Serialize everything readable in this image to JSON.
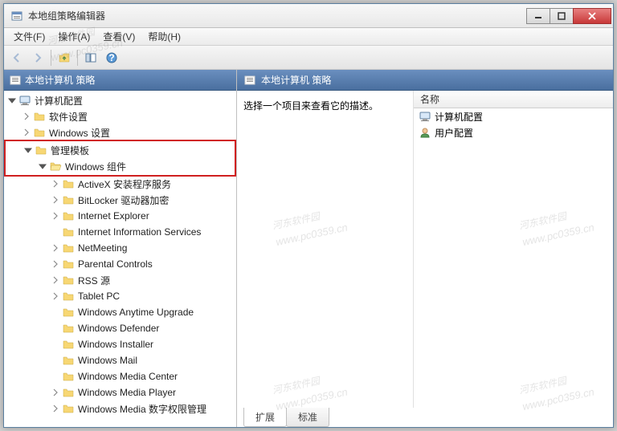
{
  "window": {
    "title": "本地组策略编辑器"
  },
  "menu": {
    "file": "文件(F)",
    "action": "操作(A)",
    "view": "查看(V)",
    "help": "帮助(H)"
  },
  "tree": {
    "root": "本地计算机 策略",
    "computer_config": "计算机配置",
    "software_settings": "软件设置",
    "windows_settings": "Windows 设置",
    "admin_templates": "管理模板",
    "windows_components": "Windows 组件",
    "items": [
      "ActiveX 安装程序服务",
      "BitLocker 驱动器加密",
      "Internet Explorer",
      "Internet Information Services",
      "NetMeeting",
      "Parental Controls",
      "RSS 源",
      "Tablet PC",
      "Windows Anytime Upgrade",
      "Windows Defender",
      "Windows Installer",
      "Windows Mail",
      "Windows Media Center",
      "Windows Media Player",
      "Windows Media 数字权限管理"
    ]
  },
  "right": {
    "title": "本地计算机 策略",
    "description": "选择一个项目来查看它的描述。",
    "col_name": "名称",
    "items": [
      {
        "label": "计算机配置",
        "icon": "computer"
      },
      {
        "label": "用户配置",
        "icon": "user"
      }
    ]
  },
  "tabs": {
    "extended": "扩展",
    "standard": "标准"
  },
  "watermark": {
    "text": "河东软件园",
    "url": "www.pc0359.cn"
  }
}
